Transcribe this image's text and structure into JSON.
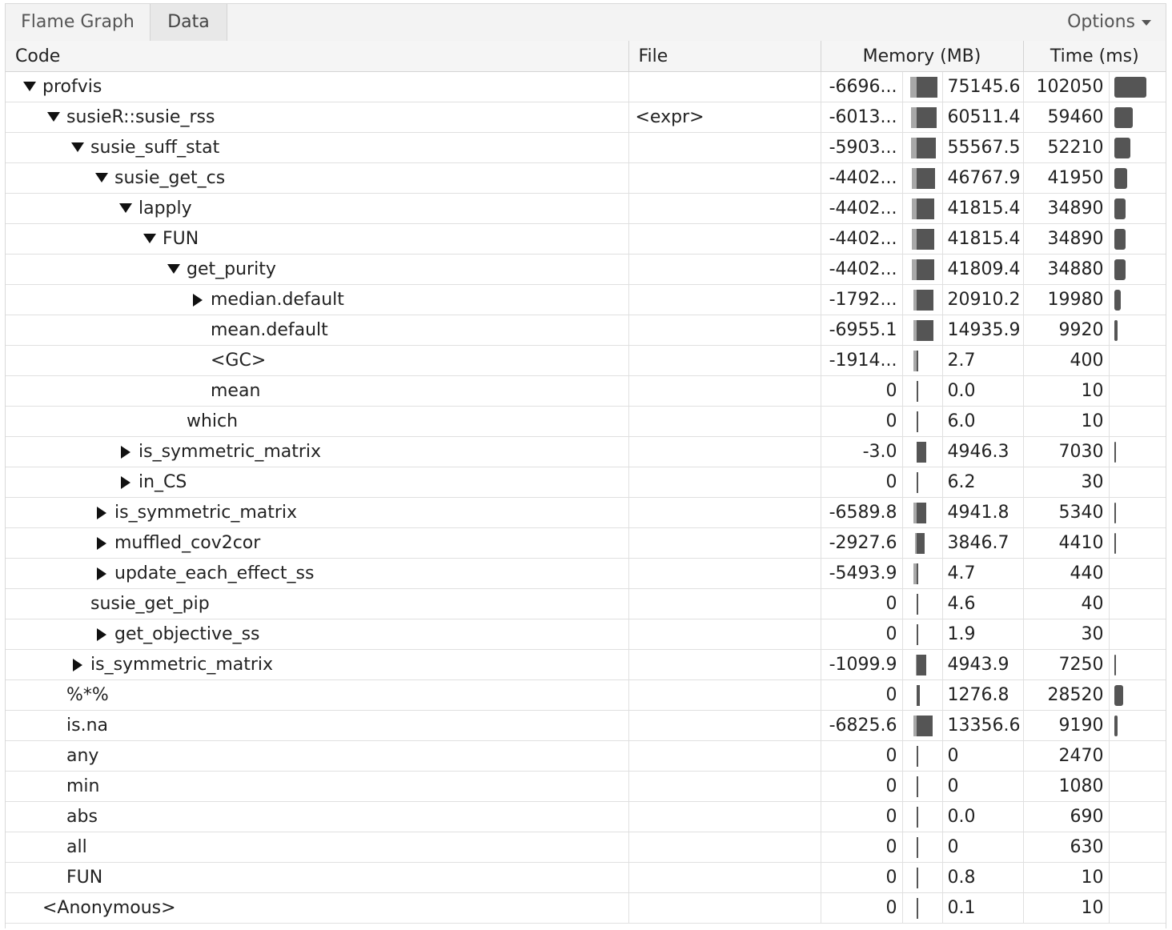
{
  "tabs": [
    {
      "label": "Flame Graph",
      "active": false
    },
    {
      "label": "Data",
      "active": true
    }
  ],
  "options_label": "Options",
  "columns": {
    "code": "Code",
    "file": "File",
    "memory": "Memory (MB)",
    "time": "Time (ms)"
  },
  "colors": {
    "bar_dark": "#555555",
    "bar_light": "#a8a8a8",
    "header_bg": "#f5f5f5"
  },
  "rows": [
    {
      "label": "profvis",
      "depth": 0,
      "toggle": "expanded",
      "file": "",
      "mem_neg": "-6696...",
      "mem_pos": "75145.6",
      "time": "102050",
      "neg_frac": 0.55,
      "pos_frac": 1.0,
      "time_frac": 1.0
    },
    {
      "label": "susieR::susie_rss",
      "depth": 1,
      "toggle": "expanded",
      "file": "<expr>",
      "mem_neg": "-6013...",
      "mem_pos": "60511.4",
      "time": "59460",
      "neg_frac": 0.5,
      "pos_frac": 0.95,
      "time_frac": 0.58
    },
    {
      "label": "susie_suff_stat",
      "depth": 2,
      "toggle": "expanded",
      "file": "",
      "mem_neg": "-5903...",
      "mem_pos": "55567.5",
      "time": "52210",
      "neg_frac": 0.49,
      "pos_frac": 0.93,
      "time_frac": 0.51
    },
    {
      "label": "susie_get_cs",
      "depth": 3,
      "toggle": "expanded",
      "file": "",
      "mem_neg": "-4402...",
      "mem_pos": "46767.9",
      "time": "41950",
      "neg_frac": 0.4,
      "pos_frac": 0.88,
      "time_frac": 0.41
    },
    {
      "label": "lapply",
      "depth": 4,
      "toggle": "expanded",
      "file": "",
      "mem_neg": "-4402...",
      "mem_pos": "41815.4",
      "time": "34890",
      "neg_frac": 0.4,
      "pos_frac": 0.85,
      "time_frac": 0.34
    },
    {
      "label": "FUN",
      "depth": 5,
      "toggle": "expanded",
      "file": "",
      "mem_neg": "-4402...",
      "mem_pos": "41815.4",
      "time": "34890",
      "neg_frac": 0.4,
      "pos_frac": 0.85,
      "time_frac": 0.34
    },
    {
      "label": "get_purity",
      "depth": 6,
      "toggle": "expanded",
      "file": "",
      "mem_neg": "-4402...",
      "mem_pos": "41809.4",
      "time": "34880",
      "neg_frac": 0.4,
      "pos_frac": 0.85,
      "time_frac": 0.34
    },
    {
      "label": "median.default",
      "depth": 7,
      "toggle": "collapsed",
      "file": "",
      "mem_neg": "-1792...",
      "mem_pos": "20910.2",
      "time": "19980",
      "neg_frac": 0.3,
      "pos_frac": 0.8,
      "time_frac": 0.19
    },
    {
      "label": "mean.default",
      "depth": 7,
      "toggle": "none",
      "file": "",
      "mem_neg": "-6955.1",
      "mem_pos": "14935.9",
      "time": "9920",
      "neg_frac": 0.3,
      "pos_frac": 0.8,
      "time_frac": 0.09
    },
    {
      "label": "<GC>",
      "depth": 7,
      "toggle": "none",
      "file": "",
      "mem_neg": "-1914...",
      "mem_pos": "2.7",
      "time": "400",
      "neg_frac": 0.3,
      "pos_frac": 0.02,
      "time_frac": 0
    },
    {
      "label": "mean",
      "depth": 7,
      "toggle": "none",
      "file": "",
      "mem_neg": "0",
      "mem_pos": "0.0",
      "time": "10",
      "neg_frac": 0,
      "pos_frac": 0.02,
      "time_frac": 0
    },
    {
      "label": "which",
      "depth": 6,
      "toggle": "none",
      "file": "",
      "mem_neg": "0",
      "mem_pos": "6.0",
      "time": "10",
      "neg_frac": 0,
      "pos_frac": 0.02,
      "time_frac": 0
    },
    {
      "label": "is_symmetric_matrix",
      "depth": 4,
      "toggle": "collapsed",
      "file": "",
      "mem_neg": "-3.0",
      "mem_pos": "4946.3",
      "time": "7030",
      "neg_frac": 0,
      "pos_frac": 0.45,
      "time_frac": 0.06
    },
    {
      "label": "in_CS",
      "depth": 4,
      "toggle": "collapsed",
      "file": "",
      "mem_neg": "0",
      "mem_pos": "6.2",
      "time": "30",
      "neg_frac": 0,
      "pos_frac": 0.02,
      "time_frac": 0
    },
    {
      "label": "is_symmetric_matrix",
      "depth": 3,
      "toggle": "collapsed",
      "file": "",
      "mem_neg": "-6589.8",
      "mem_pos": "4941.8",
      "time": "5340",
      "neg_frac": 0.3,
      "pos_frac": 0.45,
      "time_frac": 0.05
    },
    {
      "label": "muffled_cov2cor",
      "depth": 3,
      "toggle": "collapsed",
      "file": "",
      "mem_neg": "-2927.6",
      "mem_pos": "3846.7",
      "time": "4410",
      "neg_frac": 0.12,
      "pos_frac": 0.4,
      "time_frac": 0.05
    },
    {
      "label": "update_each_effect_ss",
      "depth": 3,
      "toggle": "collapsed",
      "file": "",
      "mem_neg": "-5493.9",
      "mem_pos": "4.7",
      "time": "440",
      "neg_frac": 0.25,
      "pos_frac": 0.02,
      "time_frac": 0
    },
    {
      "label": "susie_get_pip",
      "depth": 2,
      "toggle": "none",
      "file": "",
      "mem_neg": "0",
      "mem_pos": "4.6",
      "time": "40",
      "neg_frac": 0,
      "pos_frac": 0.02,
      "time_frac": 0
    },
    {
      "label": "get_objective_ss",
      "depth": 3,
      "toggle": "collapsed",
      "file": "",
      "mem_neg": "0",
      "mem_pos": "1.9",
      "time": "30",
      "neg_frac": 0,
      "pos_frac": 0.02,
      "time_frac": 0
    },
    {
      "label": "is_symmetric_matrix",
      "depth": 2,
      "toggle": "collapsed",
      "file": "",
      "mem_neg": "-1099.9",
      "mem_pos": "4943.9",
      "time": "7250",
      "neg_frac": 0.05,
      "pos_frac": 0.45,
      "time_frac": 0.06
    },
    {
      "label": "%*%",
      "depth": 1,
      "toggle": "none",
      "file": "",
      "mem_neg": "0",
      "mem_pos": "1276.8",
      "time": "28520",
      "neg_frac": 0,
      "pos_frac": 0.15,
      "time_frac": 0.28
    },
    {
      "label": "is.na",
      "depth": 1,
      "toggle": "none",
      "file": "",
      "mem_neg": "-6825.6",
      "mem_pos": "13356.6",
      "time": "9190",
      "neg_frac": 0.3,
      "pos_frac": 0.78,
      "time_frac": 0.09
    },
    {
      "label": "any",
      "depth": 1,
      "toggle": "none",
      "file": "",
      "mem_neg": "0",
      "mem_pos": "0",
      "time": "2470",
      "neg_frac": 0,
      "pos_frac": 0.02,
      "time_frac": 0
    },
    {
      "label": "min",
      "depth": 1,
      "toggle": "none",
      "file": "",
      "mem_neg": "0",
      "mem_pos": "0",
      "time": "1080",
      "neg_frac": 0,
      "pos_frac": 0.02,
      "time_frac": 0
    },
    {
      "label": "abs",
      "depth": 1,
      "toggle": "none",
      "file": "",
      "mem_neg": "0",
      "mem_pos": "0.0",
      "time": "690",
      "neg_frac": 0,
      "pos_frac": 0.02,
      "time_frac": 0
    },
    {
      "label": "all",
      "depth": 1,
      "toggle": "none",
      "file": "",
      "mem_neg": "0",
      "mem_pos": "0",
      "time": "630",
      "neg_frac": 0,
      "pos_frac": 0.02,
      "time_frac": 0
    },
    {
      "label": "FUN",
      "depth": 1,
      "toggle": "none",
      "file": "",
      "mem_neg": "0",
      "mem_pos": "0.8",
      "time": "10",
      "neg_frac": 0,
      "pos_frac": 0.02,
      "time_frac": 0
    },
    {
      "label": "<Anonymous>",
      "depth": 0,
      "toggle": "none",
      "file": "",
      "mem_neg": "0",
      "mem_pos": "0.1",
      "time": "10",
      "neg_frac": 0,
      "pos_frac": 0.02,
      "time_frac": 0
    }
  ]
}
